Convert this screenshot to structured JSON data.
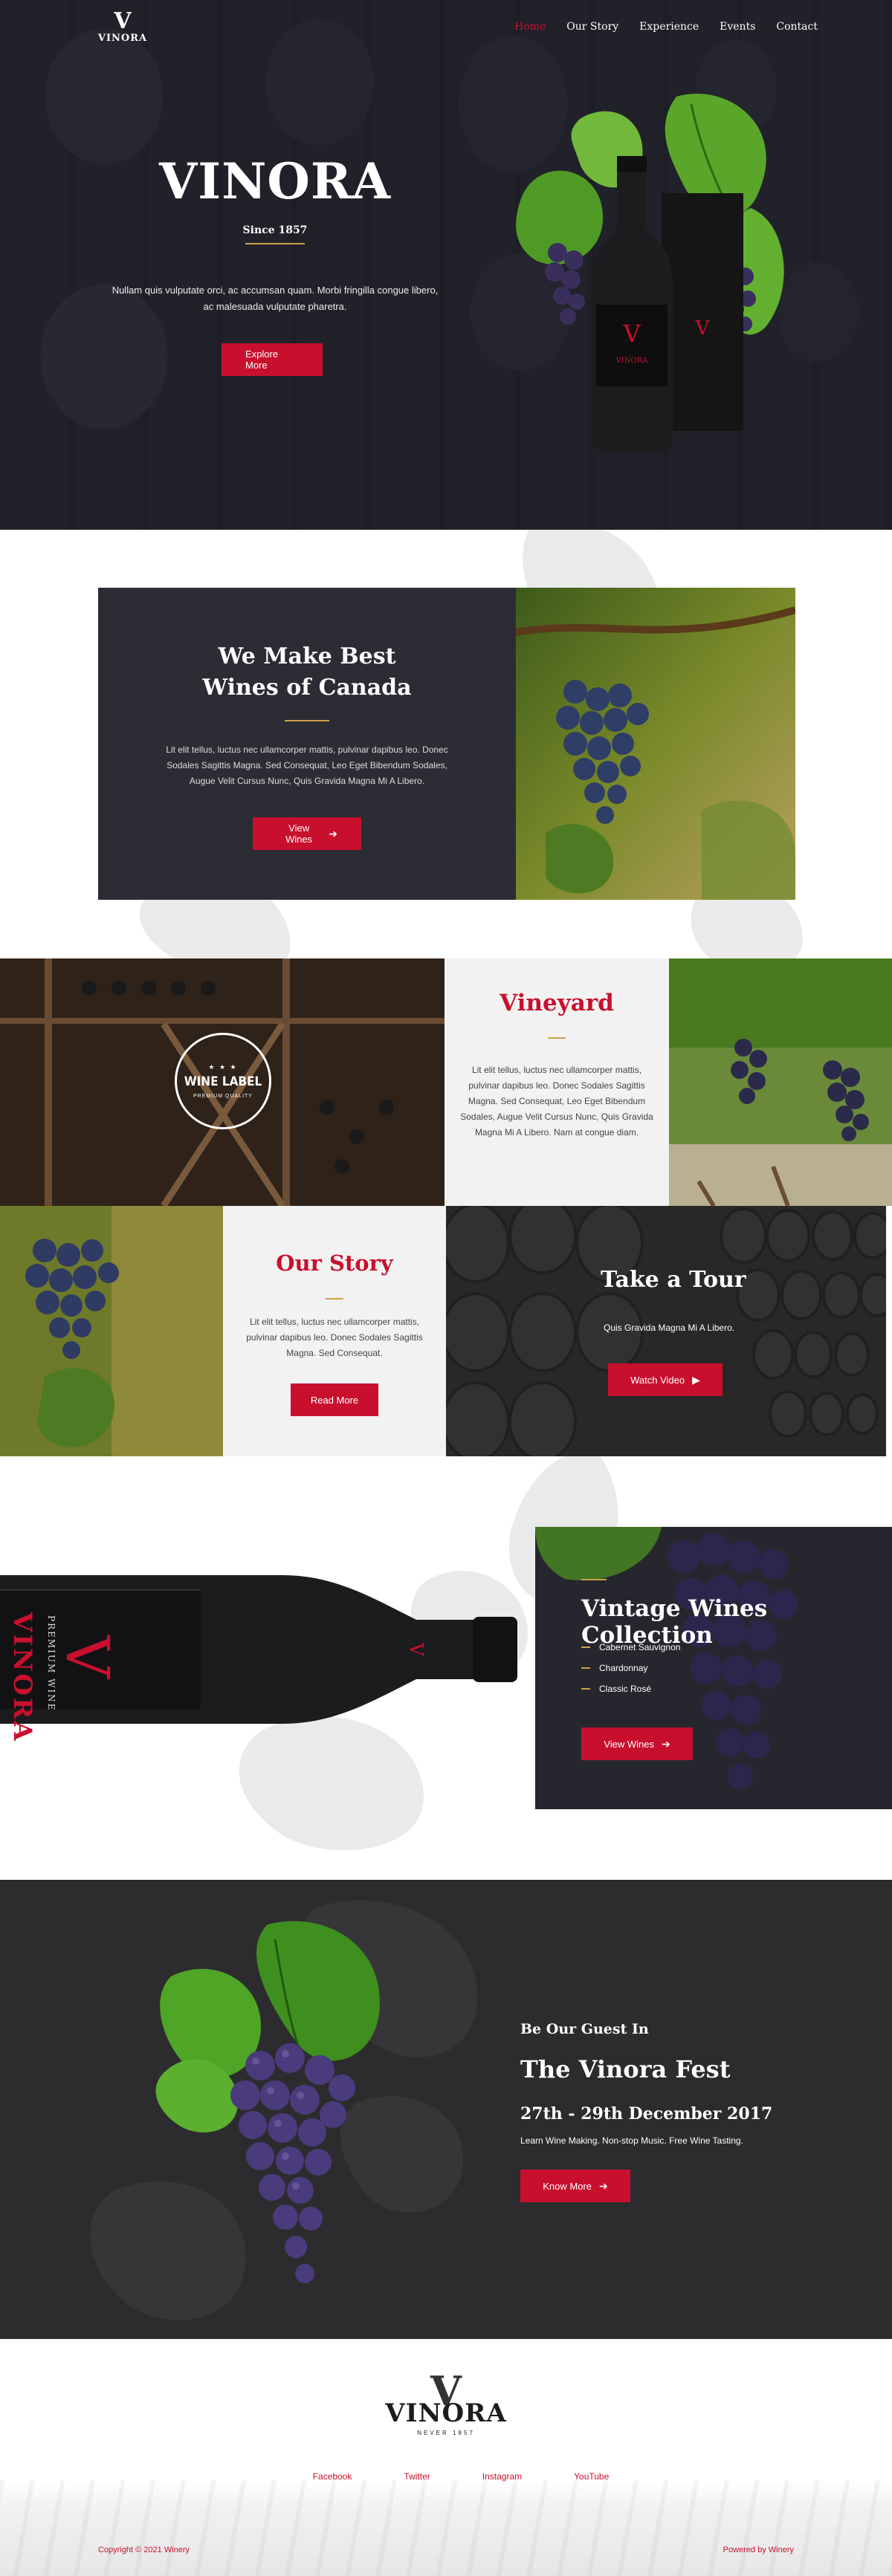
{
  "header": {
    "logo_letter": "V",
    "logo_text": "VINORA",
    "nav": [
      "Home",
      "Our Story",
      "Experience",
      "Events",
      "Contact"
    ]
  },
  "hero": {
    "title": "VINORA",
    "since": "Since 1857",
    "text": "Nullam quis vulputate orci, ac accumsan quam. Morbi fringilla congue libero, ac malesuada vulputate pharetra.",
    "button": "Explore More"
  },
  "about": {
    "title_line1": "We Make Best",
    "title_line2": "Wines of Canada",
    "text": "Lit elit tellus, luctus nec ullamcorper mattis, pulvinar dapibus leo. Donec Sodales Sagittis Magna. Sed Consequat, Leo Eget Bibendum Sodales, Augue Velit Cursus Nunc, Quis Gravida Magna Mi A Libero.",
    "button": "View Wines"
  },
  "grid": {
    "wine_label": "WINE LABEL",
    "wine_label_sub": "PREMIUM QUALITY",
    "vineyard_title": "Vineyard",
    "vineyard_text": "Lit elit tellus, luctus nec ullamcorper mattis, pulvinar dapibus leo. Donec Sodales Sagittis Magna. Sed Consequat, Leo Eget Bibendum Sodales, Augue Velit Cursus Nunc, Quis Gravida Magna Mi A Libero. Nam at congue diam.",
    "story_title": "Our Story",
    "story_text": "Lit elit tellus, luctus nec ullamcorper mattis, pulvinar dapibus leo. Donec Sodales Sagittis Magna. Sed Consequat.",
    "story_button": "Read More",
    "tour_title": "Take a Tour",
    "tour_text": "Quis Gravida Magna Mi A Libero.",
    "tour_button": "Watch Video"
  },
  "collection": {
    "title": "Vintage Wines Collection",
    "items": [
      "Cabernet Sauvignon",
      "Chardonnay",
      "Classic Rosé"
    ],
    "button": "View Wines",
    "bottle_brand": "VINORA",
    "bottle_sub": "PREMIUM WINE"
  },
  "fest": {
    "kicker": "Be Our Guest In",
    "title": "The Vinora Fest",
    "date": "27th - 29th December 2017",
    "text": "Learn Wine Making. Non-stop Music. Free Wine Tasting.",
    "button": "Know More"
  },
  "footer": {
    "logo_letter": "V",
    "logo_text": "VINORA",
    "logo_sub": "NEVER 1857",
    "links": [
      "Facebook",
      "Twitter",
      "Instagram",
      "YouTube"
    ],
    "copyright": "Copyright © 2021 Winery",
    "powered": "Powered by Winery"
  },
  "colors": {
    "accent": "#c8102e",
    "gold": "#c9a24a",
    "dark": "#2c2d34"
  }
}
